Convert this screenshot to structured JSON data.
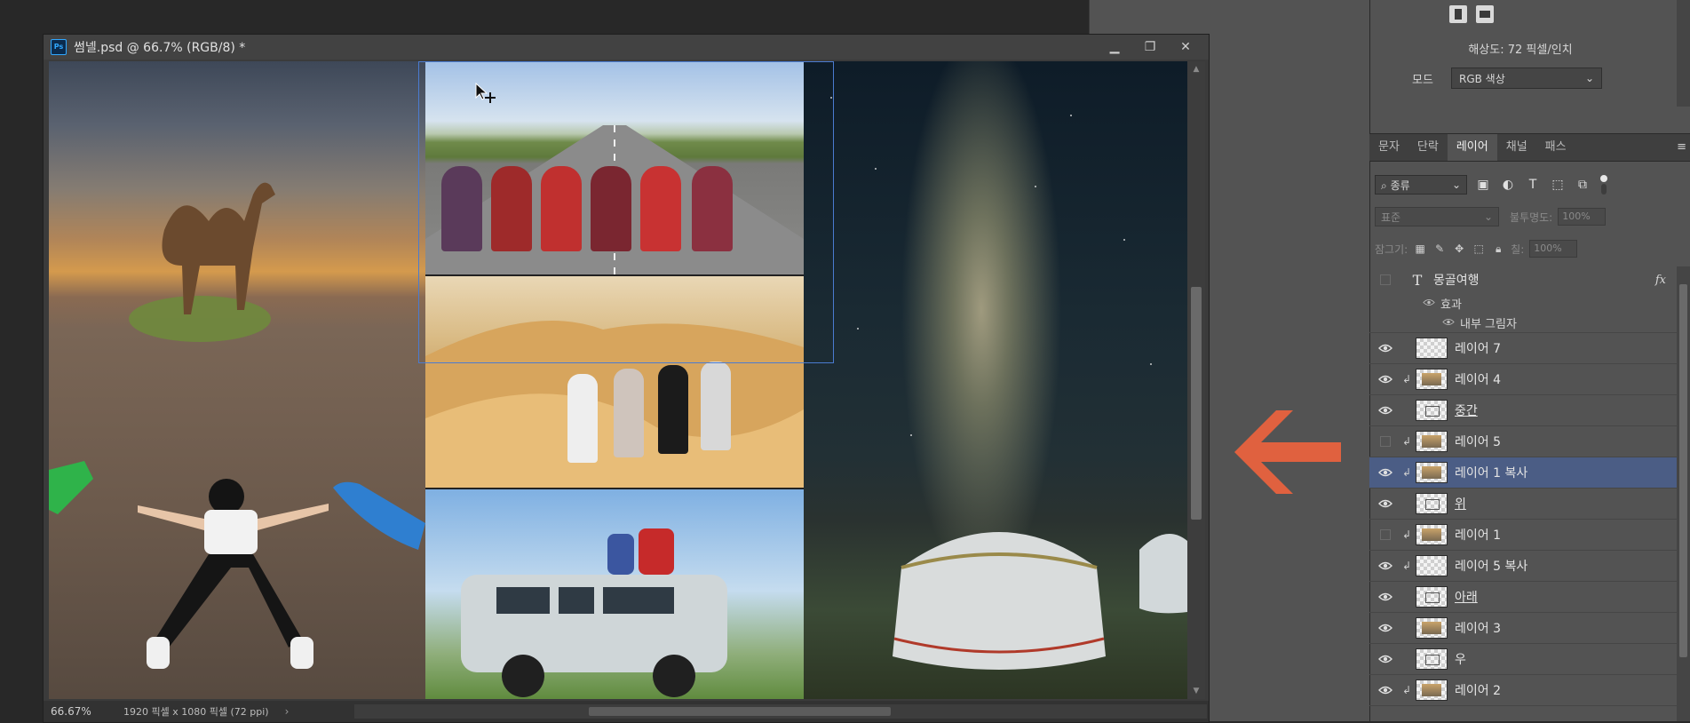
{
  "document": {
    "title": "썸넬.psd @ 66.7% (RGB/8) *",
    "app_badge": "Ps",
    "window_buttons": [
      "minimize-icon",
      "restore-icon",
      "close-icon"
    ]
  },
  "status_bar": {
    "zoom": "66.67%",
    "doc_size": "1920 픽셀 x 1080 픽셀 (72 ppi)",
    "arrow": "›"
  },
  "properties": {
    "resolution": "해상도: 72 픽셀/인치",
    "mode_label": "모드",
    "mode_value": "RGB 색상"
  },
  "tabs": [
    {
      "label": "문자",
      "active": false
    },
    {
      "label": "단락",
      "active": false
    },
    {
      "label": "레이어",
      "active": true
    },
    {
      "label": "채널",
      "active": false
    },
    {
      "label": "패스",
      "active": false
    }
  ],
  "filter": {
    "kind_label": "종류"
  },
  "blend": {
    "mode": "표준",
    "opacity_label": "불투명도:",
    "opacity_value": "100%"
  },
  "lock": {
    "label": "잠그기:",
    "fill_label": "칠:",
    "fill_value": "100%"
  },
  "layers": [
    {
      "name": "몽골여행",
      "type": "text",
      "visible": false,
      "fx": "fx"
    },
    {
      "name": "레이어 7",
      "type": "image",
      "visible": true,
      "clip": false
    },
    {
      "name": "레이어 4",
      "type": "image",
      "visible": true,
      "clip": true
    },
    {
      "name": "중간",
      "type": "frame",
      "visible": true,
      "clip": false
    },
    {
      "name": "레이어 5",
      "type": "image",
      "visible": false,
      "clip": true
    },
    {
      "name": "레이어 1 복사",
      "type": "image",
      "visible": true,
      "clip": true,
      "selected": true
    },
    {
      "name": "위",
      "type": "frame",
      "visible": true,
      "clip": false
    },
    {
      "name": "레이어 1",
      "type": "image",
      "visible": false,
      "clip": true
    },
    {
      "name": "레이어 5 복사",
      "type": "image",
      "visible": true,
      "clip": true
    },
    {
      "name": "아래",
      "type": "frame",
      "visible": true,
      "clip": false
    },
    {
      "name": "레이어 3",
      "type": "image",
      "visible": true,
      "clip": false
    },
    {
      "name": "우",
      "type": "frame",
      "visible": true,
      "clip": false
    },
    {
      "name": "레이어 2",
      "type": "image",
      "visible": true,
      "clip": true
    }
  ],
  "effects": {
    "title": "효과",
    "inner_shadow": "내부 그림자"
  },
  "colors": {
    "accent_arrow": "#e0613f",
    "selected_layer": "#4b5d85",
    "selection_rect": "#4a7bd0"
  }
}
